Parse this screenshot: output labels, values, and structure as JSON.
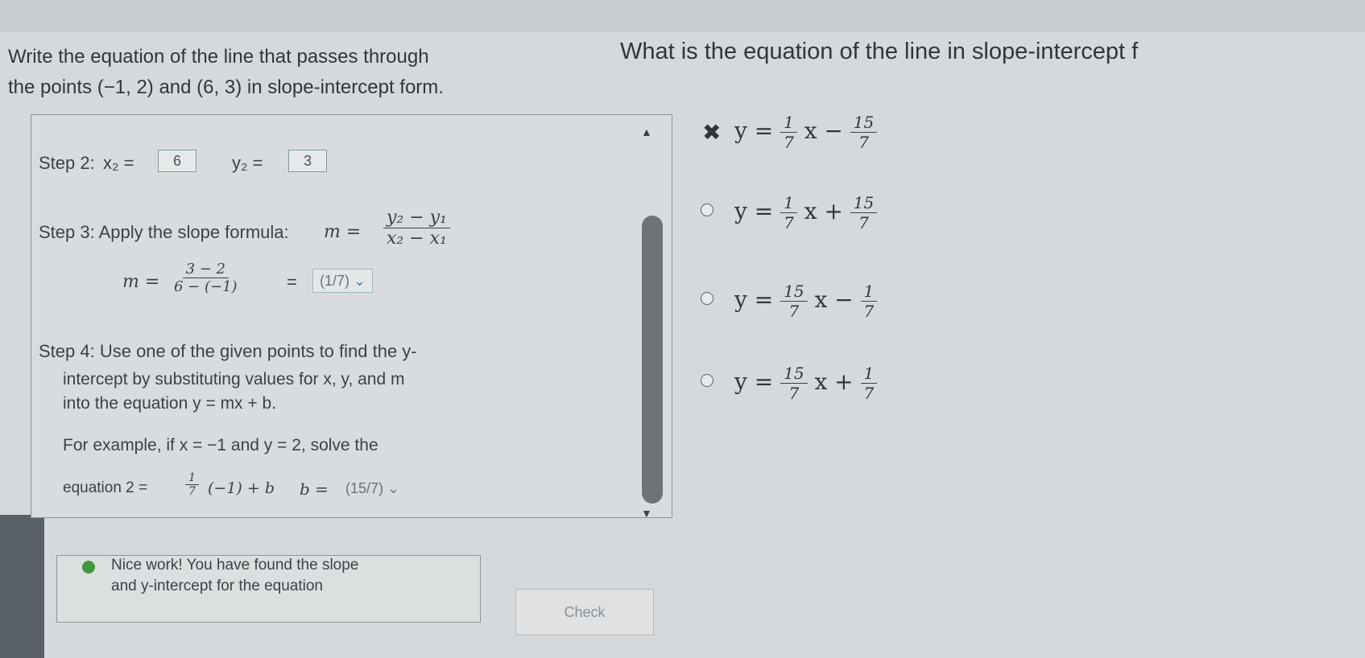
{
  "prompt": {
    "line1": "Write the equation of the line that passes through",
    "line2_prefix": "the points",
    "point1": "(−1, 2)",
    "and": "and",
    "point2": "(6, 3)",
    "line2_suffix": "in slope-intercept form."
  },
  "question": "What is the equation of the line in slope-intercept f",
  "step2": {
    "label": "Step 2:",
    "x2_label": "x₂ =",
    "x2_value": "6",
    "y2_label": "y₂ =",
    "y2_value": "3"
  },
  "step3": {
    "text": "Step 3: Apply the slope formula:",
    "m": "m =",
    "num": "y₂ − y₁",
    "den": "x₂ − x₁",
    "calc_num": "3 − 2",
    "calc_den": "6 − (−1)",
    "eq": "=",
    "dropdown": "(1/7)",
    "chev": "⌄"
  },
  "step4": {
    "line1": "Step 4: Use one of the given points to find the y-",
    "line2": "intercept by substituting values for x, y, and m",
    "line3": "into the equation y = mx + b.",
    "line4": "For example, if x = −1 and y = 2, solve the",
    "line5_a": "equation 2 =",
    "frac_num": "1",
    "frac_den": "7",
    "line5_b": "(−1) + b",
    "b_label": "b =",
    "b_dropdown": "(15/7)",
    "chev": "⌄"
  },
  "options": [
    {
      "prefix": "y =",
      "a_num": "1",
      "a_den": "7",
      "mid": "x −",
      "b_num": "15",
      "b_den": "7",
      "marker": "✖"
    },
    {
      "prefix": "y =",
      "a_num": "1",
      "a_den": "7",
      "mid": "x +",
      "b_num": "15",
      "b_den": "7"
    },
    {
      "prefix": "y =",
      "a_num": "15",
      "a_den": "7",
      "mid": "x −",
      "b_num": "1",
      "b_den": "7"
    },
    {
      "prefix": "y =",
      "a_num": "15",
      "a_den": "7",
      "mid": "x +",
      "b_num": "1",
      "b_den": "7"
    }
  ],
  "feedback": {
    "line1": "Nice work! You have found the slope",
    "line2": "and y-intercept for the equation"
  },
  "check_label": "Check",
  "scroll": {
    "up": "▲",
    "down": "▼"
  },
  "colors": {
    "correct_icon": "#3c9a3a",
    "wrong_mark": "#3a4148"
  }
}
